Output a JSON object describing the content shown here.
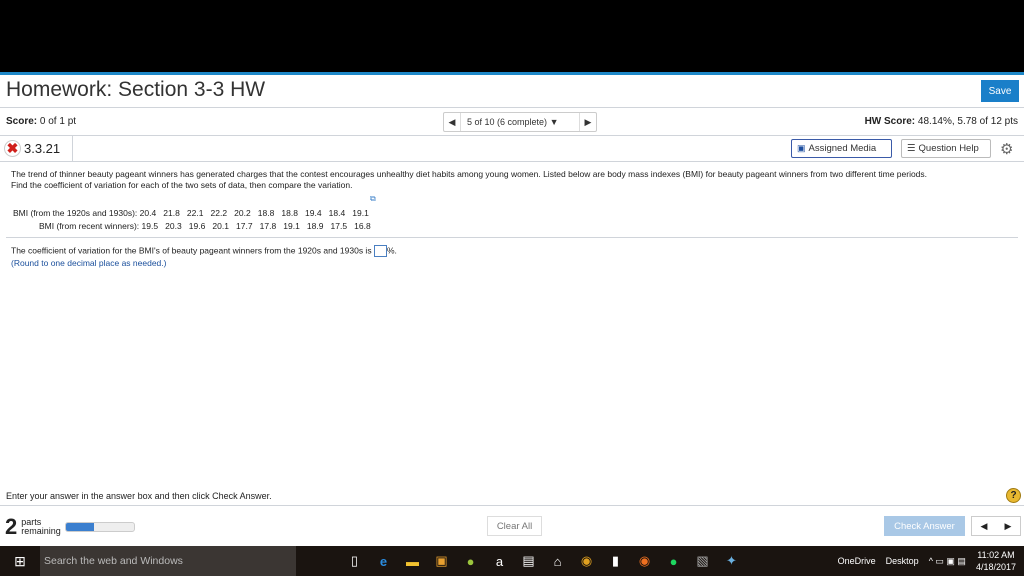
{
  "header": {
    "title": "Homework: Section 3-3 HW",
    "save_label": "Save"
  },
  "status": {
    "score_label": "Score:",
    "score_value": "0 of 1 pt",
    "nav_text": "5 of 10 (6 complete)",
    "hw_score_label": "HW Score:",
    "hw_score_value": "48.14%, 5.78 of 12 pts"
  },
  "question": {
    "number": "3.3.21",
    "assigned_media": "Assigned Media",
    "question_help": "Question Help",
    "text1": "The trend of thinner beauty pageant winners has generated charges that the contest encourages unhealthy diet habits among young women. Listed below are body mass indexes (BMI) for beauty pageant winners from two different time periods.",
    "text2": "Find the coefficient of variation for each of the two sets of data, then compare the variation.",
    "row1_label": "BMI (from the 1920s and 1930s):",
    "row1_values": "20.4   21.8   22.1   22.2   20.2   18.8   18.8   19.4   18.4   19.1",
    "row2_label": "BMI (from recent winners):",
    "row2_values": "19.5   20.3   19.6   20.1   17.7   17.8   19.1   18.9   17.5   16.8",
    "prompt_before": "The coefficient of variation for the BMI's of beauty pageant winners from the 1920s and 1930s is ",
    "prompt_after": "%.",
    "hint": "(Round to one decimal place as needed.)"
  },
  "footer": {
    "instruction": "Enter your answer in the answer box and then click Check Answer.",
    "parts_count": "2",
    "parts_label1": "parts",
    "parts_label2": "remaining",
    "progress": 0.42,
    "clear_all": "Clear All",
    "check_answer": "Check Answer"
  },
  "taskbar": {
    "search": "Search the web and Windows",
    "onedrive": "OneDrive",
    "desktop": "Desktop",
    "time": "11:02 AM",
    "date": "4/18/2017"
  }
}
